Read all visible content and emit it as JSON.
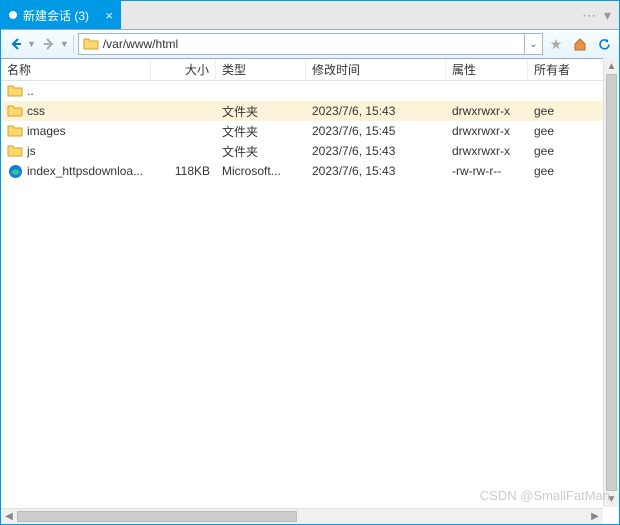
{
  "tab": {
    "title": "新建会话 (3)"
  },
  "address": {
    "path": "/var/www/html"
  },
  "columns": {
    "name": "名称",
    "size": "大小",
    "type": "类型",
    "mtime": "修改时间",
    "attr": "属性",
    "owner": "所有者"
  },
  "rows": [
    {
      "icon": "folder-up",
      "name": "..",
      "size": "",
      "type": "",
      "mtime": "",
      "attr": "",
      "owner": "",
      "selected": false
    },
    {
      "icon": "folder",
      "name": "css",
      "size": "",
      "type": "文件夹",
      "mtime": "2023/7/6, 15:43",
      "attr": "drwxrwxr-x",
      "owner": "gee",
      "selected": true
    },
    {
      "icon": "folder",
      "name": "images",
      "size": "",
      "type": "文件夹",
      "mtime": "2023/7/6, 15:45",
      "attr": "drwxrwxr-x",
      "owner": "gee",
      "selected": false
    },
    {
      "icon": "folder",
      "name": "js",
      "size": "",
      "type": "文件夹",
      "mtime": "2023/7/6, 15:43",
      "attr": "drwxrwxr-x",
      "owner": "gee",
      "selected": false
    },
    {
      "icon": "edge",
      "name": "index_httpsdownloa...",
      "size": "118KB",
      "type": "Microsoft...",
      "mtime": "2023/7/6, 15:43",
      "attr": "-rw-rw-r--",
      "owner": "gee",
      "selected": false
    }
  ],
  "watermark": "CSDN @SmallFatMan"
}
